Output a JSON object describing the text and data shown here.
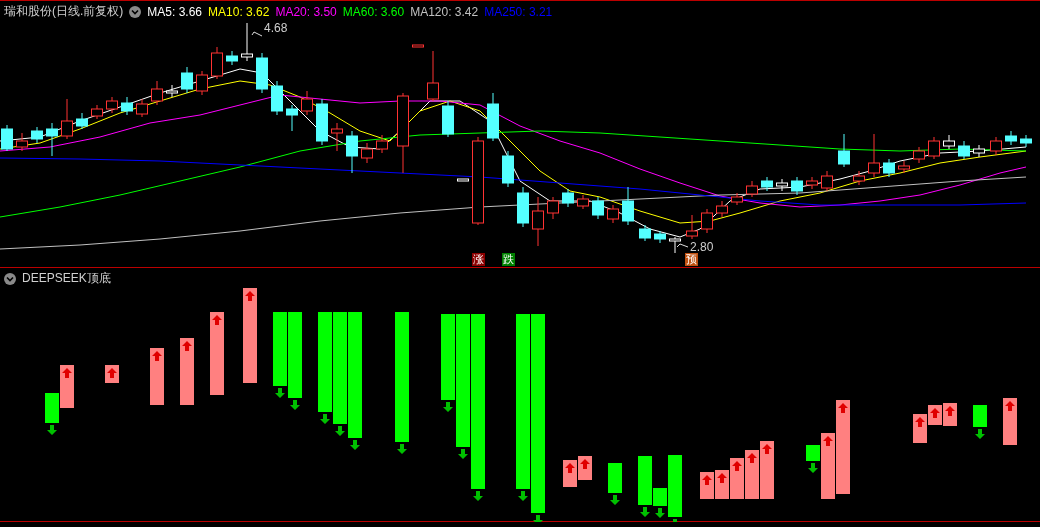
{
  "main_chart": {
    "title": "瑞和股份(日线.前复权)",
    "indicators": [
      {
        "label": "MA5: 3.66",
        "color": "#ffffff"
      },
      {
        "label": "MA10: 3.62",
        "color": "#ffff00"
      },
      {
        "label": "MA20: 3.50",
        "color": "#ff00ff"
      },
      {
        "label": "MA60: 3.60",
        "color": "#00ff00"
      },
      {
        "label": "MA120: 3.42",
        "color": "#c0c0c0"
      },
      {
        "label": "MA250: 3.21",
        "color": "#0000ff"
      }
    ],
    "high_marker": "4.68",
    "low_marker": "2.80",
    "signals": [
      {
        "label": "涨",
        "kind": "up"
      },
      {
        "label": "跌",
        "kind": "down"
      },
      {
        "label": "预",
        "kind": "warn"
      }
    ]
  },
  "sub_chart": {
    "title": "DEEPSEEK顶底"
  }
}
